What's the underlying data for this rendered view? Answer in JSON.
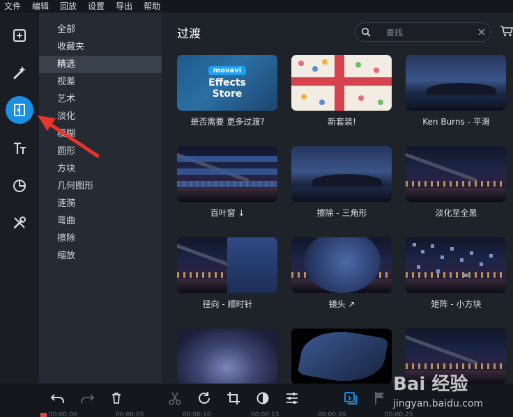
{
  "menu": [
    "文件",
    "编辑",
    "回放",
    "设置",
    "导出",
    "帮助"
  ],
  "tools": [
    {
      "name": "import-icon"
    },
    {
      "name": "magic-wand-icon"
    },
    {
      "name": "transitions-icon",
      "active": true
    },
    {
      "name": "titles-icon"
    },
    {
      "name": "stickers-icon"
    },
    {
      "name": "tools-icon"
    }
  ],
  "categories": [
    "全部",
    "收藏夹",
    "精选",
    "视差",
    "艺术",
    "淡化",
    "模糊",
    "圆形",
    "方块",
    "几何图形",
    "涟漪",
    "弯曲",
    "擦除",
    "缩放"
  ],
  "selected_category": "精选",
  "main": {
    "title": "过渡",
    "search_placeholder": "查找"
  },
  "store_tile": {
    "badge": "movavi",
    "line1": "Effects",
    "line2": "Store"
  },
  "tiles": [
    {
      "caption": "是否需要 更多过渡?"
    },
    {
      "caption": "新套装!"
    },
    {
      "caption": "Ken Burns - 平滑"
    },
    {
      "caption": "百叶窗 ↓"
    },
    {
      "caption": "擦除 - 三角形"
    },
    {
      "caption": "淡化至全黑"
    },
    {
      "caption": "径向 - 顺时针"
    },
    {
      "caption": "镜头 ↗"
    },
    {
      "caption": "矩阵 - 小方块"
    },
    {
      "caption": ""
    },
    {
      "caption": ""
    },
    {
      "caption": ""
    }
  ],
  "timeline": {
    "ticks": [
      "00:00:00",
      "00:00:05",
      "00:00:10",
      "00:00:15",
      "00:00:20",
      "00:00:25"
    ]
  },
  "watermark": {
    "text": "Bai 经验",
    "url": "jingyan.baidu.com"
  },
  "colors": {
    "accent": "#1a8fe6",
    "annotation": "#e8352b"
  }
}
